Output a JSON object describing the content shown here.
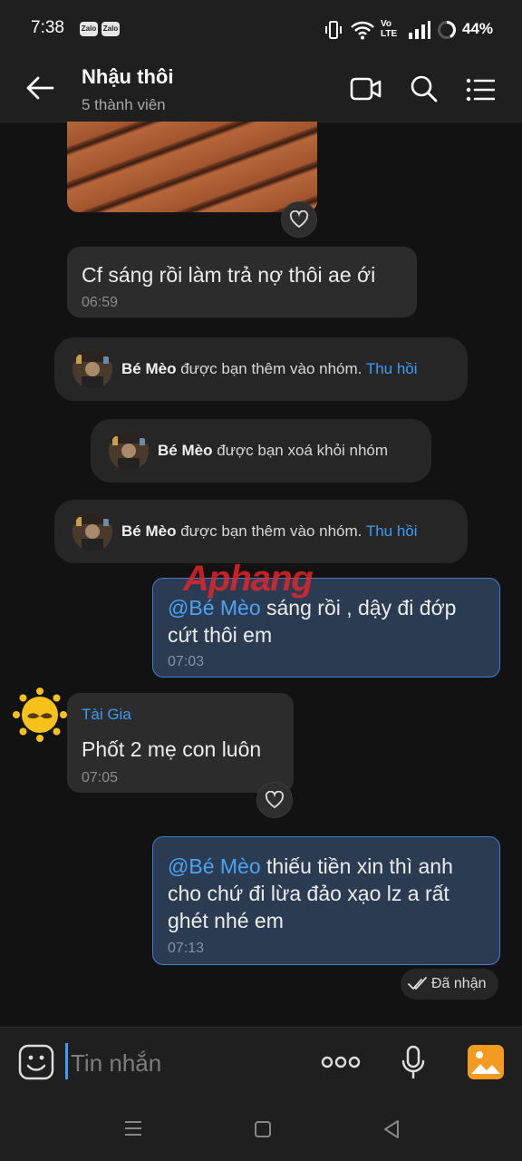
{
  "status_bar": {
    "time": "7:38",
    "app_badges": [
      "Zalo",
      "Zalo"
    ],
    "network_label": "Vo LTE",
    "battery": "44%"
  },
  "header": {
    "group_name": "Nhậu thôi",
    "members": "5 thành viên",
    "icons": [
      "back-arrow-icon",
      "video-call-icon",
      "search-icon",
      "menu-icon"
    ]
  },
  "messages": {
    "m1": {
      "text": "Cf sáng rồi làm trả nợ thôi ae ới",
      "time": "06:59"
    },
    "notice1": {
      "name": "Bé Mèo",
      "action": " được bạn thêm vào nhóm. ",
      "link": "Thu hồi"
    },
    "notice2": {
      "name": "Bé Mèo",
      "action": " được bạn xoá khỏi nhóm"
    },
    "notice3": {
      "name": "Bé Mèo",
      "action": " được bạn thêm vào nhóm. ",
      "link": "Thu hồi"
    },
    "m2": {
      "mention": "@Bé Mèo",
      "text1": " sáng rồi , dậy đi đớp",
      "text2": "cứt thôi em",
      "time": "07:03"
    },
    "m3": {
      "sender": "Tài Gia",
      "text": "Phốt 2 mẹ con luôn",
      "time": "07:05"
    },
    "m4": {
      "mention": "@Bé Mèo",
      "text1": " thiếu tiền xin thì anh",
      "text2": "cho chứ đi lừa đảo xạo lz a rất",
      "text3": "ghét nhé em",
      "time": "07:13"
    },
    "received_status": "Đã nhận"
  },
  "watermark": "Aphang",
  "input": {
    "placeholder": "Tin nhắn"
  },
  "colors": {
    "accent": "#3b9df6",
    "sent_bubble": "#2b3c52",
    "sent_border": "#3f7fc9",
    "background": "#121212"
  }
}
